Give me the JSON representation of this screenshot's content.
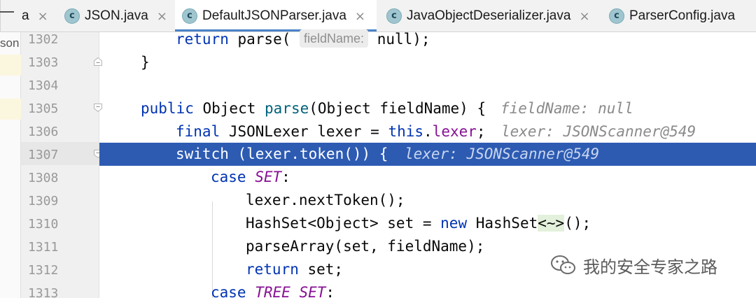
{
  "tabs": [
    {
      "label": "a",
      "icon": "none",
      "active": false
    },
    {
      "label": "JSON.java",
      "icon": "class-icon",
      "active": false
    },
    {
      "label": "DefaultJSONParser.java",
      "icon": "class-icon",
      "active": true
    },
    {
      "label": "JavaObjectDeserializer.java",
      "icon": "class-icon",
      "active": false
    },
    {
      "label": "ParserConfig.java",
      "icon": "class-icon",
      "active": false
    }
  ],
  "tab_icon_letter": "c",
  "tab_close_glyph": "×",
  "left_strip_text": "son",
  "line_numbers": [
    "1302",
    "1303",
    "1304",
    "1305",
    "1306",
    "1307",
    "1308",
    "1309",
    "1310",
    "1311",
    "1312",
    "1313"
  ],
  "selected_line": "1307",
  "code": {
    "l1302": {
      "kw": "return",
      "call": " parse( ",
      "hint_label": "fieldName:",
      "rest": " null);"
    },
    "l1303": {
      "text": "}"
    },
    "l1305": {
      "kw": "public",
      "type": " Object ",
      "fn": "parse",
      "args": "(Object fieldName) {",
      "hint": "fieldName: null"
    },
    "l1306": {
      "kw": "final",
      "decl": " JSONLexer lexer = ",
      "this": "this",
      "dot": ".",
      "fld": "lexer",
      "semi": ";",
      "hint": "lexer: JSONScanner@549"
    },
    "l1307": {
      "kw": "switch",
      "rest": " (lexer.token()) {",
      "hint": "lexer: JSONScanner@549"
    },
    "l1308": {
      "kw": "case",
      "space": " ",
      "const": "SET",
      "colon": ":"
    },
    "l1309": {
      "text": "lexer.nextToken();"
    },
    "l1310": {
      "pre": "HashSet<Object> set = ",
      "kw": "new",
      "cls": " HashSet",
      "diamond": "<~>",
      "rest": "();"
    },
    "l1311": {
      "text": "parseArray(set, fieldName);"
    },
    "l1312": {
      "kw": "return",
      "rest": " set;"
    },
    "l1313": {
      "kw": "case",
      "space": " ",
      "const": "TREE_SET",
      "colon": ":"
    }
  },
  "watermark": "我的安全专家之路",
  "colors": {
    "selection": "#2d5bb2",
    "keyword": "#0033b3",
    "field": "#871094",
    "tab_underline": "#4a83c9"
  }
}
